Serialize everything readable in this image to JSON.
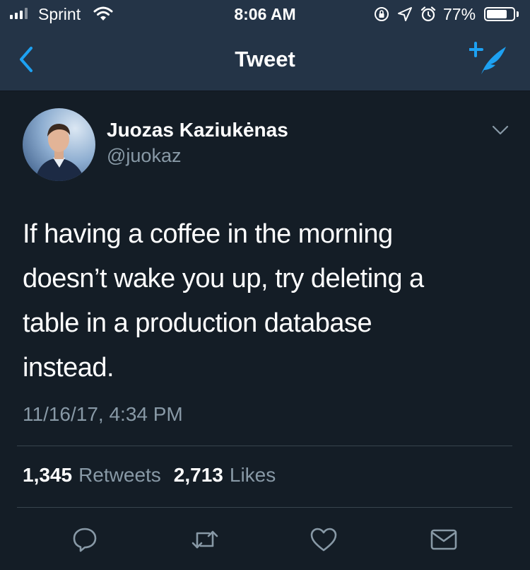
{
  "status_bar": {
    "carrier": "Sprint",
    "time": "8:06 AM",
    "battery_percent": "77%",
    "battery_level": 0.77
  },
  "nav": {
    "title": "Tweet"
  },
  "author": {
    "name": "Juozas Kaziukėnas",
    "handle": "@juokaz"
  },
  "tweet": {
    "lines": [
      "If having a coffee in the morning",
      "doesn’t wake you up, try deleting a",
      "table in a production database",
      "instead."
    ],
    "timestamp": "11/16/17, 4:34 PM"
  },
  "stats": {
    "retweets_count": "1,345",
    "retweets_label": "Retweets",
    "likes_count": "2,713",
    "likes_label": "Likes"
  },
  "colors": {
    "accent": "#1da1f2",
    "background": "#141d26",
    "header": "#243447",
    "secondary_text": "#8899a6",
    "divider": "#38444d"
  },
  "icons": [
    "signal-icon",
    "wifi-icon",
    "rotation-lock-icon",
    "location-icon",
    "alarm-icon",
    "battery-icon",
    "back-chevron-icon",
    "compose-tweet-icon",
    "chevron-down-icon",
    "reply-icon",
    "retweet-icon",
    "like-icon",
    "direct-message-icon"
  ]
}
